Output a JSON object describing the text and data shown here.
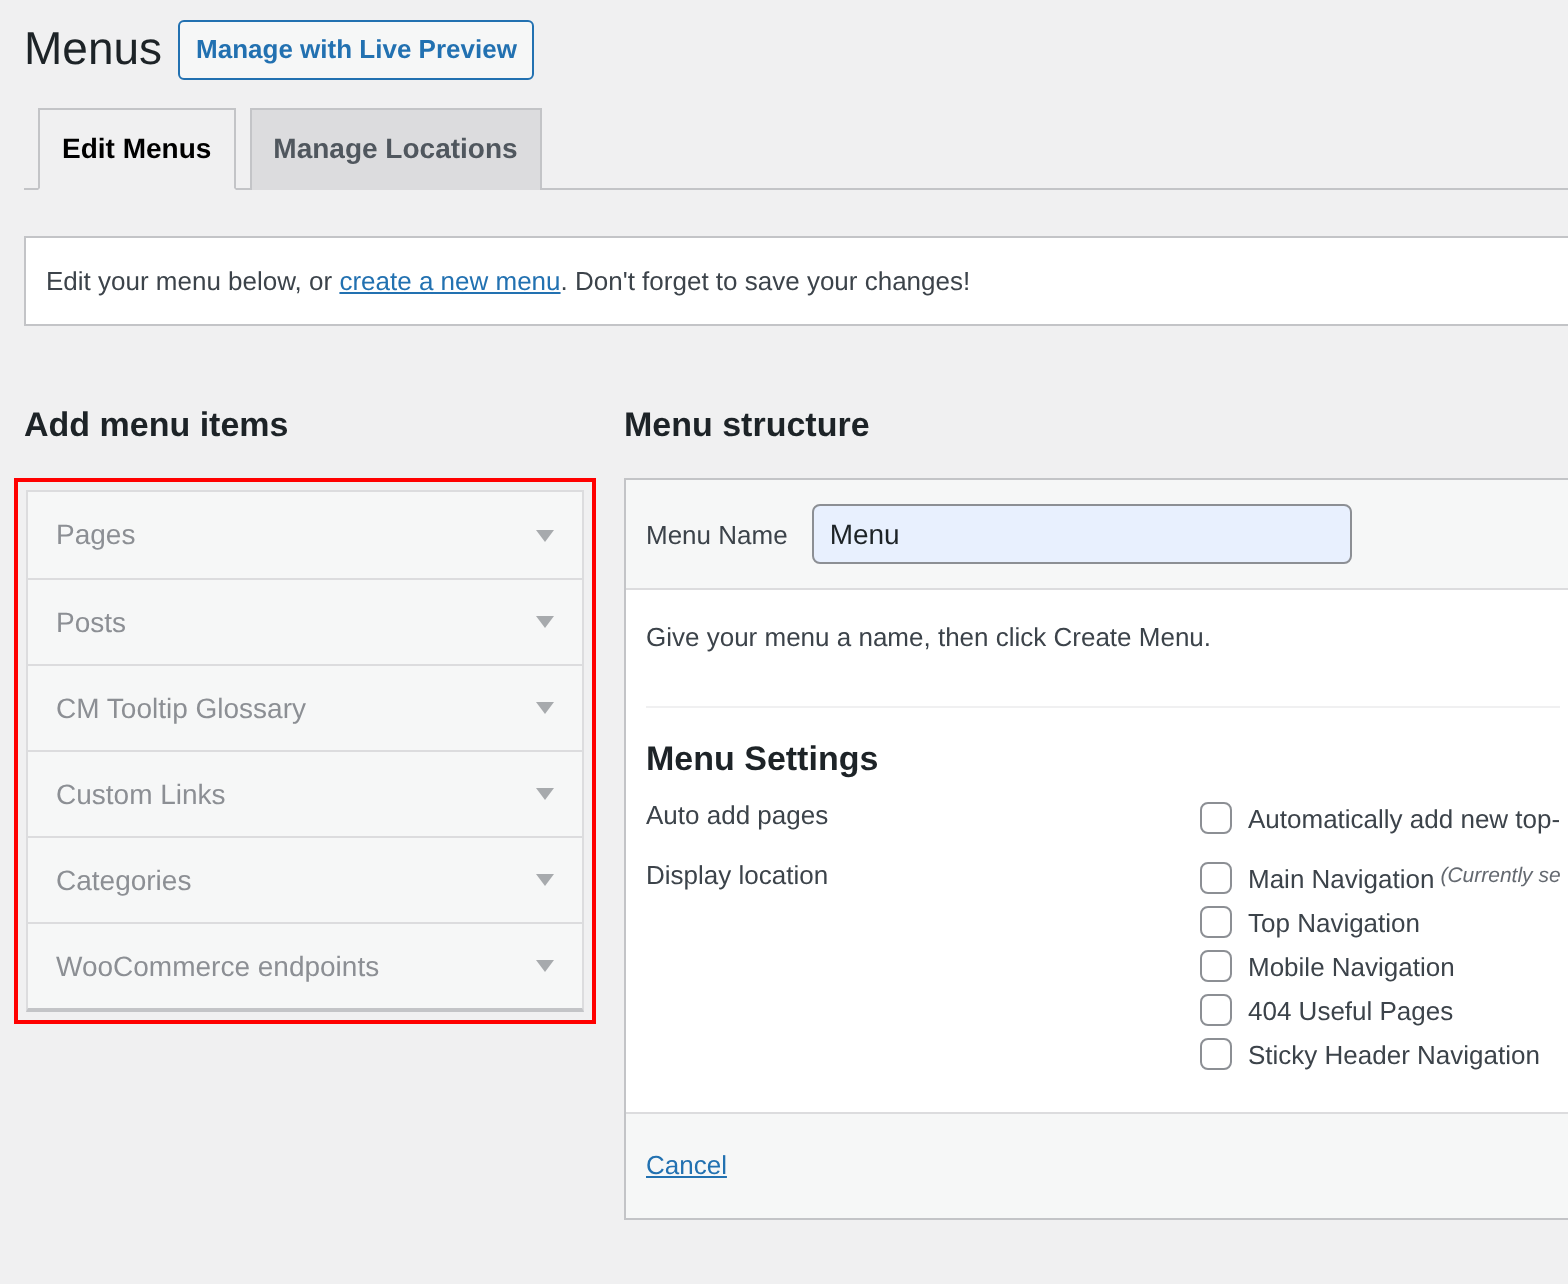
{
  "header": {
    "title": "Menus",
    "action_button": "Manage with Live Preview"
  },
  "tabs": [
    {
      "label": "Edit Menus",
      "selected": true
    },
    {
      "label": "Manage Locations",
      "selected": false
    }
  ],
  "notice": {
    "text_before": "Edit your menu below, or ",
    "link": "create a new menu",
    "text_after": ". Don't forget to save your changes!"
  },
  "add_menu_items": {
    "title": "Add menu items",
    "highlighted": true,
    "sections": [
      {
        "label": "Pages",
        "expanded": false
      },
      {
        "label": "Posts",
        "expanded": false
      },
      {
        "label": "CM Tooltip Glossary",
        "expanded": false
      },
      {
        "label": "Custom Links",
        "expanded": false
      },
      {
        "label": "Categories",
        "expanded": false
      },
      {
        "label": "WooCommerce endpoints",
        "expanded": false
      }
    ]
  },
  "menu_structure": {
    "title": "Menu structure",
    "name_label": "Menu Name",
    "name_value": "Menu",
    "instructions": "Give your menu a name, then click Create Menu.",
    "settings_title": "Menu Settings",
    "settings": [
      {
        "label": "Auto add pages",
        "options": [
          {
            "label": "Automatically add new top-",
            "checked": false
          }
        ]
      },
      {
        "label": "Display location",
        "options": [
          {
            "label": "Main Navigation",
            "note": "(Currently se",
            "checked": false
          },
          {
            "label": "Top Navigation",
            "checked": false
          },
          {
            "label": "Mobile Navigation",
            "checked": false
          },
          {
            "label": "404 Useful Pages",
            "checked": false
          },
          {
            "label": "Sticky Header Navigation",
            "checked": false
          }
        ]
      }
    ],
    "cancel_link": "Cancel"
  }
}
